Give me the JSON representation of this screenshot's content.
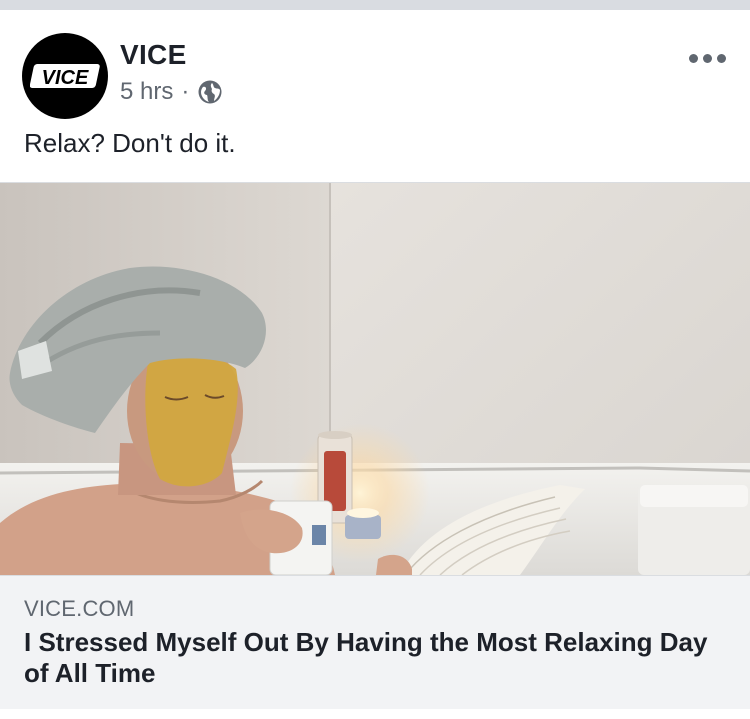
{
  "post": {
    "page_name": "VICE",
    "timestamp": "5 hrs",
    "separator": "·",
    "privacy_icon": "globe-icon",
    "avatar_logo_text": "VICE",
    "more_options_icon": "ellipsis-icon",
    "text": "Relax? Don't do it."
  },
  "link_preview": {
    "domain": "VICE.COM",
    "headline": "I Stressed Myself Out By Having the Most Relaxing Day of All Time",
    "image_description_icon": "photo"
  },
  "colors": {
    "text_primary": "#1d2129",
    "text_secondary": "#606770",
    "caption_bg": "#f2f3f5",
    "divider": "#dadde1"
  }
}
